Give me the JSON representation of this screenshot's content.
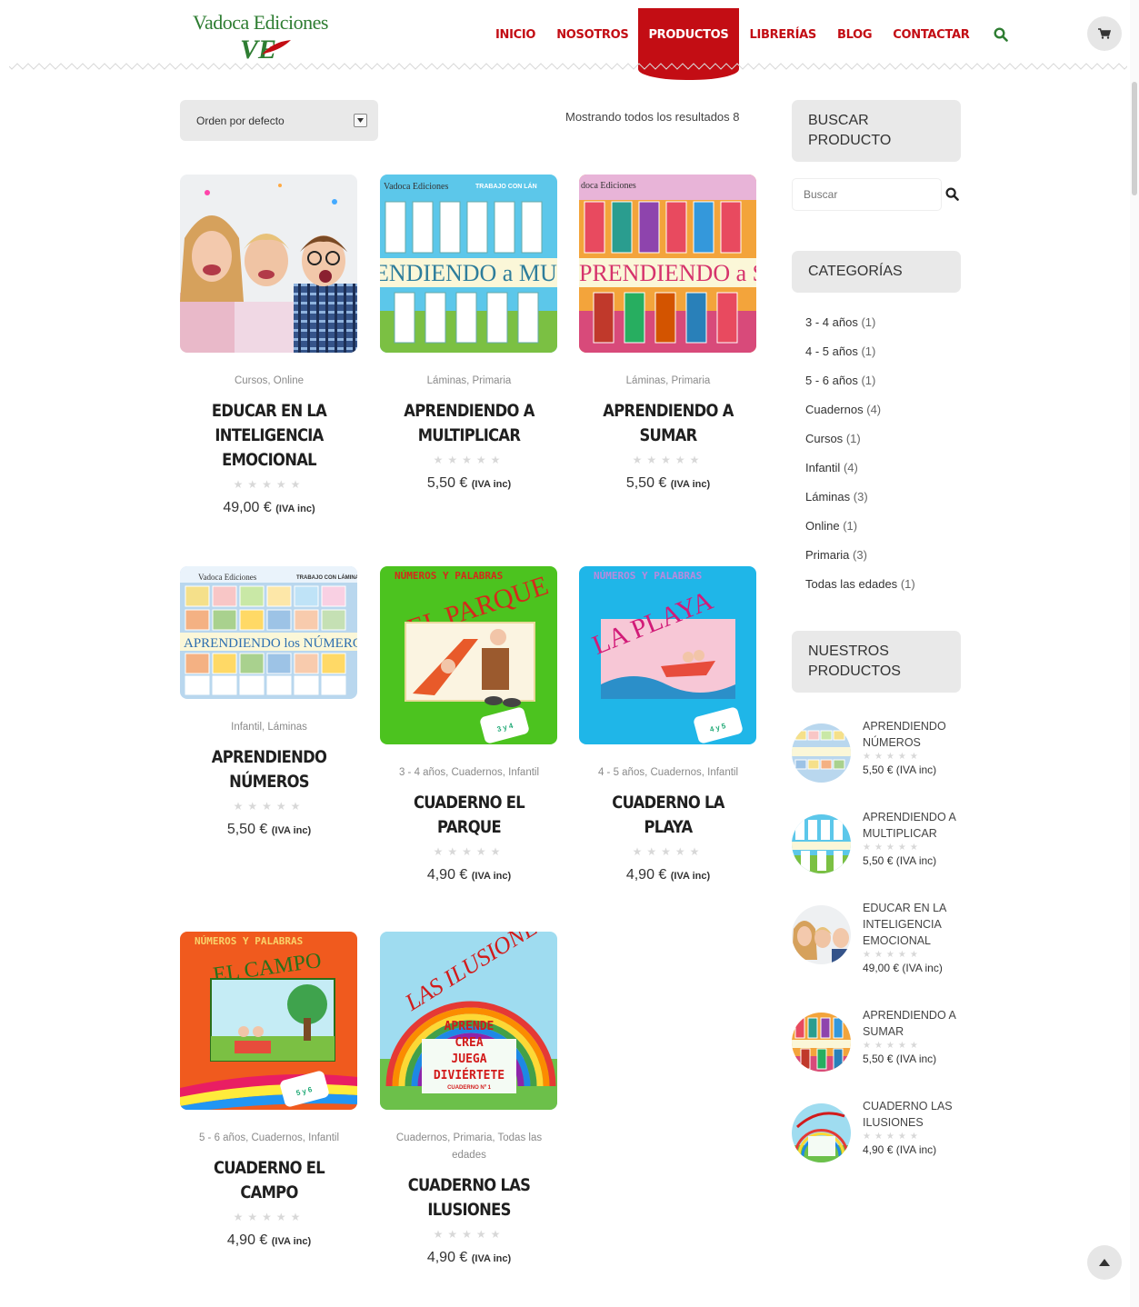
{
  "brand": {
    "name": "Vadoca Ediciones",
    "mark": "VE"
  },
  "nav": {
    "items": [
      {
        "label": "INICIO",
        "active": false
      },
      {
        "label": "NOSOTROS",
        "active": false
      },
      {
        "label": "PRODUCTOS",
        "active": true
      },
      {
        "label": "LIBRERÍAS",
        "active": false
      },
      {
        "label": "BLOG",
        "active": false
      },
      {
        "label": "CONTACTAR",
        "active": false
      }
    ],
    "accent_color": "#c30d14"
  },
  "shop": {
    "orderby": "Orden por defecto",
    "result_count": "Mostrando todos los resultados 8",
    "products": [
      {
        "cats": "Cursos, Online",
        "title": "EDUCAR EN LA INTELIGENCIA EMOCIONAL",
        "price": "49,00 €",
        "tax": "(IVA inc)",
        "stars": "★★★★★"
      },
      {
        "cats": "Láminas, Primaria",
        "title": "APRENDIENDO A MULTIPLICAR",
        "price": "5,50 €",
        "tax": "(IVA inc)",
        "stars": "★★★★★",
        "img_text": "ENDIENDO a MULTIPLIC"
      },
      {
        "cats": "Láminas, Primaria",
        "title": "APRENDIENDO A SUMAR",
        "price": "5,50 €",
        "tax": "(IVA inc)",
        "stars": "★★★★★",
        "img_text": "PRENDIENDO a SUMA"
      },
      {
        "cats": "Infantil, Láminas",
        "title": "APRENDIENDO NÚMEROS",
        "price": "5,50 €",
        "tax": "(IVA inc)",
        "stars": "★★★★★",
        "img_text": "APRENDIENDO los NÚMEROS"
      },
      {
        "cats": "3 - 4 años, Cuadernos, Infantil",
        "title": "CUADERNO EL PARQUE",
        "price": "4,90 €",
        "tax": "(IVA inc)",
        "stars": "★★★★★",
        "img_header": "NÚMEROS Y PALABRAS",
        "img_text": "EL PARQUE"
      },
      {
        "cats": "4 - 5 años, Cuadernos, Infantil",
        "title": "CUADERNO LA PLAYA",
        "price": "4,90 €",
        "tax": "(IVA inc)",
        "stars": "★★★★★",
        "img_header": "NÚMEROS Y PALABRAS",
        "img_text": "LA PLAYA"
      },
      {
        "cats": "5 - 6 años, Cuadernos, Infantil",
        "title": "CUADERNO EL CAMPO",
        "price": "4,90 €",
        "tax": "(IVA inc)",
        "stars": "★★★★★",
        "img_header": "NÚMEROS Y PALABRAS",
        "img_text": "EL CAMPO"
      },
      {
        "cats": "Cuadernos, Primaria, Todas las edades",
        "title": "CUADERNO LAS ILUSIONES",
        "price": "4,90 €",
        "tax": "(IVA inc)",
        "stars": "★★★★★",
        "img_header": "LAS ILUSIONES",
        "img_lines": [
          "APRENDE",
          "CREA",
          "JUEGA",
          "DIVIÉRTETE"
        ],
        "img_sub": "CUADERNO Nº 1"
      }
    ]
  },
  "sidebar": {
    "search_title": "BUSCAR PRODUCTO",
    "search_placeholder": "Buscar",
    "categories_title": "CATEGORÍAS",
    "categories": [
      {
        "name": "3 - 4 años",
        "count": "(1)"
      },
      {
        "name": "4 - 5 años",
        "count": "(1)"
      },
      {
        "name": "5 - 6 años",
        "count": "(1)"
      },
      {
        "name": "Cuadernos",
        "count": "(4)"
      },
      {
        "name": "Cursos",
        "count": "(1)"
      },
      {
        "name": "Infantil",
        "count": "(4)"
      },
      {
        "name": "Láminas",
        "count": "(3)"
      },
      {
        "name": "Online",
        "count": "(1)"
      },
      {
        "name": "Primaria",
        "count": "(3)"
      },
      {
        "name": "Todas las edades",
        "count": "(1)"
      }
    ],
    "products_title": "NUESTROS PRODUCTOS",
    "products": [
      {
        "name": "APRENDIENDO NÚMEROS",
        "price": "5,50 € (IVA inc)",
        "stars": "★★★★★"
      },
      {
        "name": "APRENDIENDO A MULTIPLICAR",
        "price": "5,50 € (IVA inc)",
        "stars": "★★★★★"
      },
      {
        "name": "EDUCAR EN LA INTELIGENCIA EMOCIONAL",
        "price": "49,00 € (IVA inc)",
        "stars": "★★★★★"
      },
      {
        "name": "APRENDIENDO A SUMAR",
        "price": "5,50 € (IVA inc)",
        "stars": "★★★★★"
      },
      {
        "name": "CUADERNO LAS ILUSIONES",
        "price": "4,90 € (IVA inc)",
        "stars": "★★★★★"
      }
    ]
  }
}
